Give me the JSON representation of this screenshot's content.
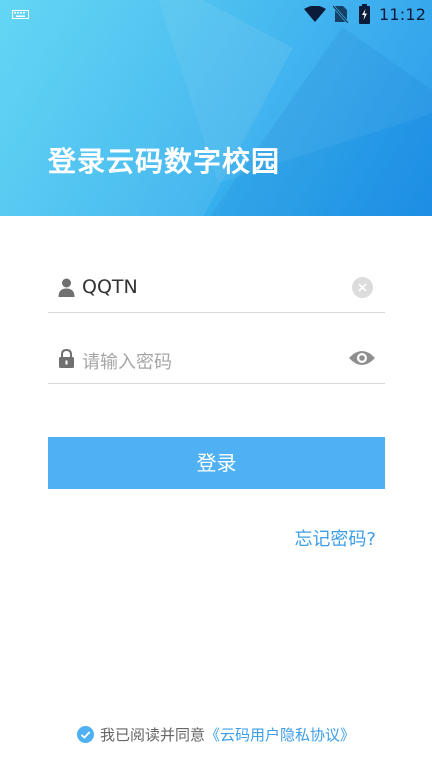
{
  "status_bar": {
    "time": "11:12",
    "icons": [
      "keyboard-icon",
      "wifi-icon",
      "no-sim-icon",
      "battery-icon"
    ]
  },
  "header": {
    "title": "登录云码数字校园",
    "gradient_colors": [
      "#57d3f3",
      "#1f94ea"
    ]
  },
  "form": {
    "username": {
      "value": "QQTN",
      "icon": "user-icon",
      "action_icon": "clear-icon"
    },
    "password": {
      "placeholder": "请输入密码",
      "icon": "lock-icon",
      "action_icon": "eye-icon"
    },
    "login_button": "登录",
    "forgot_password": "忘记密码?"
  },
  "agreement": {
    "prefix": "我已阅读并同意",
    "link": "《云码用户隐私协议》",
    "checked": true
  },
  "colors": {
    "accent": "#4fb1f3",
    "link": "#3d9ee8"
  }
}
